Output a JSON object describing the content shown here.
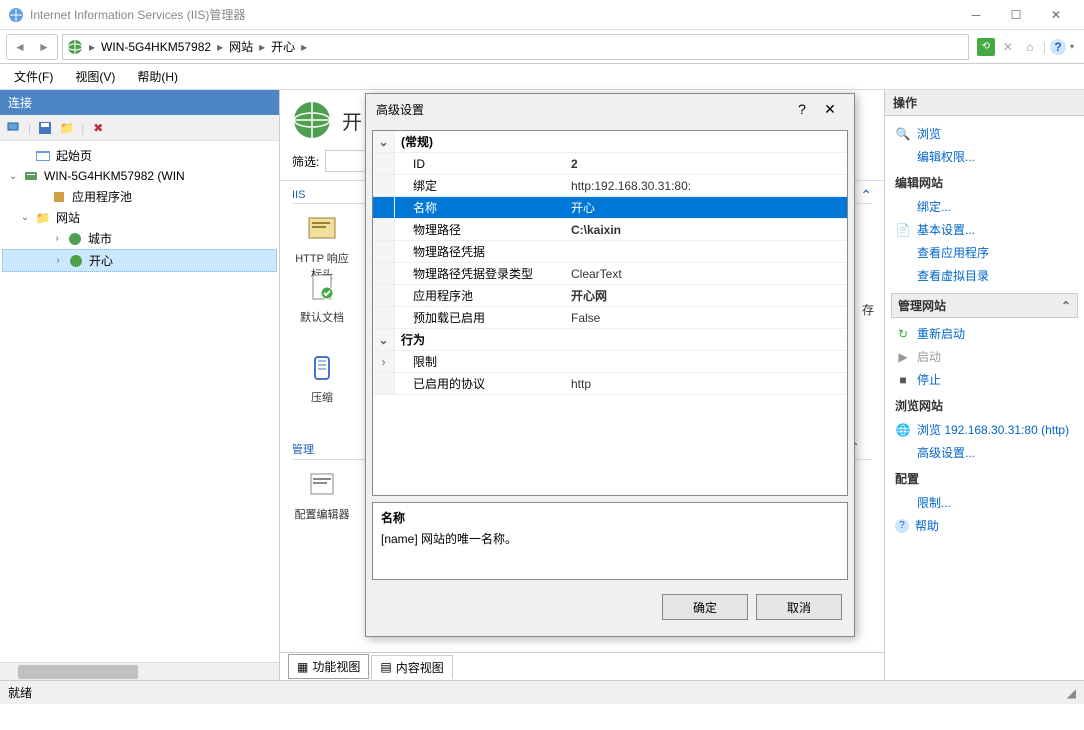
{
  "window": {
    "title": "Internet Information Services (IIS)管理器",
    "status": "就绪"
  },
  "breadcrumb": [
    "WIN-5G4HKM57982",
    "网站",
    "开心"
  ],
  "menu": {
    "file": "文件(F)",
    "view": "视图(V)",
    "help": "帮助(H)"
  },
  "connections": {
    "title": "连接",
    "tree": {
      "start": "起始页",
      "server": "WIN-5G4HKM57982 (WIN",
      "apppools": "应用程序池",
      "sites": "网站",
      "site1": "城市",
      "site2": "开心"
    }
  },
  "center": {
    "title_partial": "开",
    "filter_label": "筛选:",
    "section_iis": "IIS",
    "section_mgmt": "管理",
    "feat_http": "HTTP 响应标头",
    "feat_defdoc": "默认文档",
    "feat_compress": "压缩",
    "feat_cfgedit": "配置编辑器",
    "save_hint": "存",
    "tabs": {
      "features": "功能视图",
      "content": "内容视图"
    }
  },
  "actions": {
    "title": "操作",
    "browse": "浏览",
    "edit_perm": "编辑权限...",
    "edit_site": "编辑网站",
    "bindings": "绑定...",
    "basic": "基本设置...",
    "view_apps": "查看应用程序",
    "view_vdirs": "查看虚拟目录",
    "mgmt_site": "管理网站",
    "restart": "重新启动",
    "start": "启动",
    "stop": "停止",
    "browse_site": "浏览网站",
    "browse_url": "浏览 192.168.30.31:80 (http)",
    "advanced": "高级设置...",
    "config": "配置",
    "limits": "限制...",
    "help": "帮助"
  },
  "dialog": {
    "title": "高级设置",
    "cat_general": "(常规)",
    "cat_behavior": "行为",
    "rows": {
      "id_k": "ID",
      "id_v": "2",
      "binding_k": "绑定",
      "binding_v": "http:192.168.30.31:80:",
      "name_k": "名称",
      "name_v": "开心",
      "path_k": "物理路径",
      "path_v": "C:\\kaixin",
      "pathcred_k": "物理路径凭据",
      "pathcred_v": "",
      "pathcredtype_k": "物理路径凭据登录类型",
      "pathcredtype_v": "ClearText",
      "apppool_k": "应用程序池",
      "apppool_v": "开心网",
      "preload_k": "预加载已启用",
      "preload_v": "False",
      "limits_k": "限制",
      "limits_v": "",
      "proto_k": "已启用的协议",
      "proto_v": "http"
    },
    "desc_title": "名称",
    "desc_body": "[name] 网站的唯一名称。",
    "ok": "确定",
    "cancel": "取消"
  }
}
